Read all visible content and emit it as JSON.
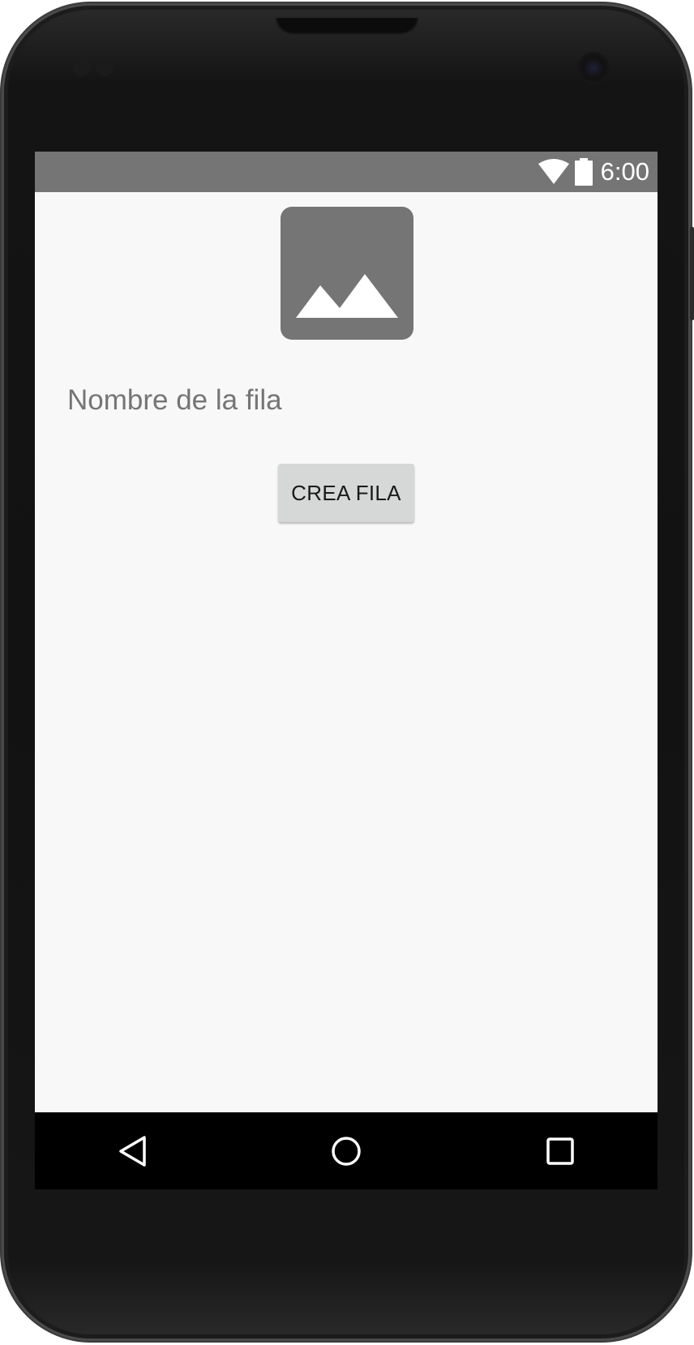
{
  "status_bar": {
    "time": "6:00",
    "icons": [
      "wifi-icon",
      "battery-icon"
    ],
    "background_color": "#757575"
  },
  "main": {
    "image_icon": "image-placeholder-icon",
    "row_name_text": "Nombre de la fila",
    "create_button_label": "CREA FILA"
  },
  "nav_bar": {
    "icons": [
      "back-icon",
      "home-icon",
      "recents-icon"
    ]
  }
}
